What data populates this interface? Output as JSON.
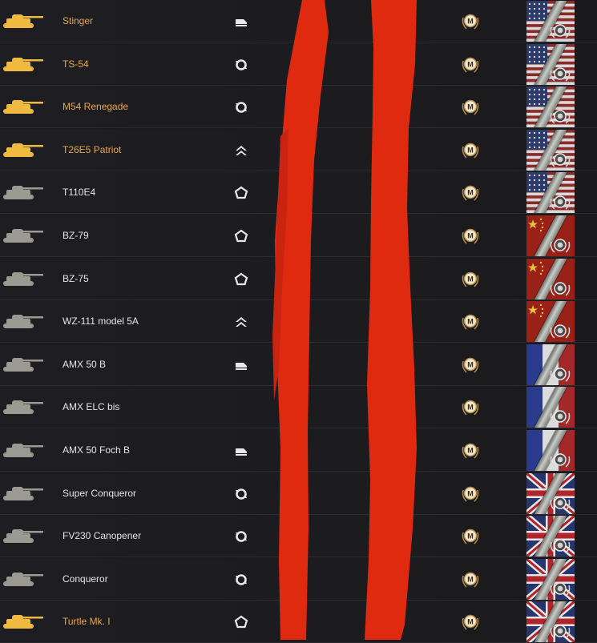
{
  "colors": {
    "premium_name": "#e8a74a",
    "normal_name": "#e6e6e6",
    "premium_tank": "#f0b940",
    "normal_tank": "#9a9a92",
    "redaction": "#e02a10",
    "mastery_gold": "#b08a4c"
  },
  "tanks": [
    {
      "name": "Stinger",
      "premium": true,
      "role_icon": "medium-wheeled-icon",
      "nation": "usa"
    },
    {
      "name": "TS-54",
      "premium": true,
      "role_icon": "versatile-cycle-icon",
      "nation": "usa"
    },
    {
      "name": "M54 Renegade",
      "premium": true,
      "role_icon": "versatile-cycle-icon",
      "nation": "usa"
    },
    {
      "name": "T26E5 Patriot",
      "premium": true,
      "role_icon": "double-chevron-icon",
      "nation": "usa"
    },
    {
      "name": "T110E4",
      "premium": false,
      "role_icon": "pentagon-icon",
      "nation": "usa"
    },
    {
      "name": "BZ-79",
      "premium": false,
      "role_icon": "pentagon-icon",
      "nation": "china"
    },
    {
      "name": "BZ-75",
      "premium": false,
      "role_icon": "pentagon-icon",
      "nation": "china"
    },
    {
      "name": "WZ-111 model 5A",
      "premium": false,
      "role_icon": "double-chevron-icon",
      "nation": "china"
    },
    {
      "name": "AMX 50 B",
      "premium": false,
      "role_icon": "medium-wheeled-icon",
      "nation": "france"
    },
    {
      "name": "AMX ELC bis",
      "premium": false,
      "role_icon": "",
      "nation": "france"
    },
    {
      "name": "AMX 50 Foch B",
      "premium": false,
      "role_icon": "medium-wheeled-icon",
      "nation": "france"
    },
    {
      "name": "Super Conqueror",
      "premium": false,
      "role_icon": "versatile-cycle-icon",
      "nation": "uk"
    },
    {
      "name": "FV230 Canopener",
      "premium": false,
      "role_icon": "versatile-cycle-icon",
      "nation": "uk"
    },
    {
      "name": "Conqueror",
      "premium": false,
      "role_icon": "versatile-cycle-icon",
      "nation": "uk"
    },
    {
      "name": "Turtle Mk. I",
      "premium": true,
      "role_icon": "pentagon-icon",
      "nation": "uk"
    }
  ],
  "mastery_label": "M"
}
